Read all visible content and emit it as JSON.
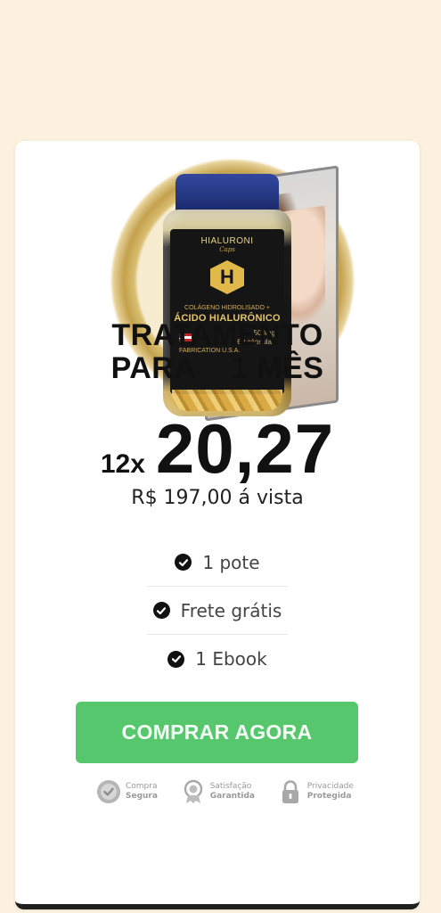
{
  "product": {
    "image_alt": "HIALURONI Caps - Colágeno Hidrolisado + Ácido Hialurônico",
    "jar_brand": "HIALURONI",
    "jar_brand_sub": "Caps",
    "jar_logo_letter": "H",
    "jar_line1": "COLÁGENO HIDROLISADO +",
    "jar_line2": "ÁCIDO HIALURÔNICO",
    "jar_dose": "500mg",
    "jar_count": "60 cápsulas",
    "jar_origin": "FABRICATION U.S.A."
  },
  "offer": {
    "title_line1": "TRATAMENTO",
    "title_line2": "PARA    1 MÊS",
    "installments_prefix": "12x",
    "installment_value": "20,27",
    "cash_price": "R$ 197,00 á vista"
  },
  "features": [
    {
      "label": "1 pote",
      "icon": "check-circle-icon"
    },
    {
      "label": "Frete grátis",
      "icon": "check-circle-icon"
    },
    {
      "label": "1 Ebook",
      "icon": "check-circle-icon"
    }
  ],
  "cta": {
    "label": "COMPRAR AGORA",
    "color": "#57c76d"
  },
  "trust_badges": [
    {
      "line1": "Compra",
      "line2": "Segura",
      "icon": "shield-check-icon"
    },
    {
      "line1": "Satisfação",
      "line2": "Garantida",
      "icon": "medal-icon"
    },
    {
      "line1": "Privacidade",
      "line2": "Protegida",
      "icon": "lock-icon"
    }
  ],
  "colors": {
    "page_bg": "#fbf1de",
    "card_bg": "#ffffff",
    "text": "#111111",
    "muted": "#9a9a9a"
  }
}
